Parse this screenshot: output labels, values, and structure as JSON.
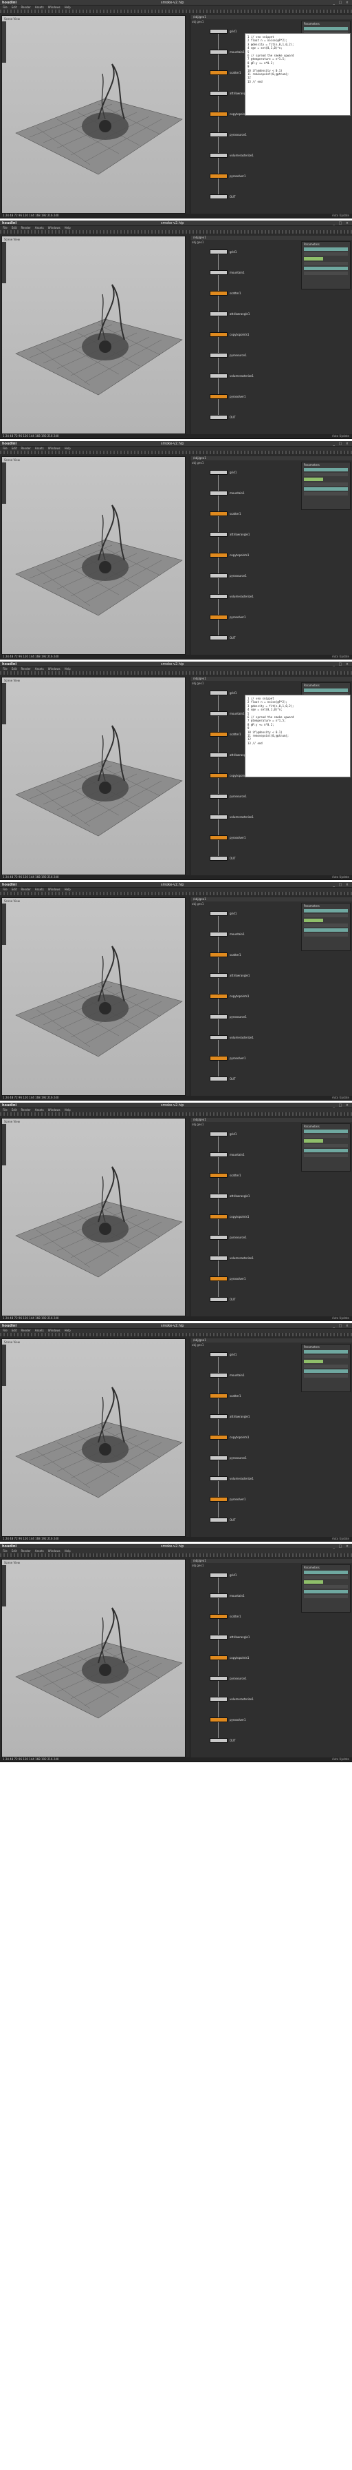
{
  "app": {
    "title": "smoke-v2.hip",
    "logo": "houdini",
    "window_controls": "_ □ ×"
  },
  "menu": [
    "File",
    "Edit",
    "Render",
    "Assets",
    "Windows",
    "Help"
  ],
  "viewport": {
    "label": "Scene View",
    "bg_color": "#bcbcbc"
  },
  "network": {
    "tab": "/obj/geo1",
    "path": "obj  geo1",
    "nodes": [
      {
        "name": "grid1",
        "color": "grey"
      },
      {
        "name": "mountain1",
        "color": "grey"
      },
      {
        "name": "scatter1",
        "color": "orange"
      },
      {
        "name": "attribwrangle1",
        "color": "grey"
      },
      {
        "name": "copytopoints1",
        "color": "orange"
      },
      {
        "name": "pyrosource1",
        "color": "grey"
      },
      {
        "name": "volumerasterize1",
        "color": "grey"
      },
      {
        "name": "pyrosolver1",
        "color": "orange"
      },
      {
        "name": "OUT",
        "color": "grey"
      }
    ]
  },
  "params": {
    "header": "Parameters"
  },
  "notes": {
    "lines": [
      "1  // vex snippet",
      "2  float n = noise(@P*2);",
      "3  @density = fit(n,0,1,0,2);",
      "4  v@v = set(0,1,0)*n;",
      "5",
      "6  // spread the smoke upward",
      "7  @temperature = n*1.5;",
      "8  @P.y += n*0.2;",
      "9",
      "10 if(@density < 0.1)",
      "11    removepoint(0,@ptnum);",
      "12",
      "13 // end"
    ]
  },
  "timeline": {
    "label": "1  24  48  72  96  120  144  168  192  216  240"
  },
  "status": {
    "text": "Auto Update"
  },
  "frames": [
    {
      "notes_visible": true
    },
    {
      "notes_visible": false
    },
    {
      "notes_visible": false
    },
    {
      "notes_visible": true
    },
    {
      "notes_visible": false
    },
    {
      "notes_visible": false
    },
    {
      "notes_visible": false
    },
    {
      "notes_visible": false
    }
  ]
}
